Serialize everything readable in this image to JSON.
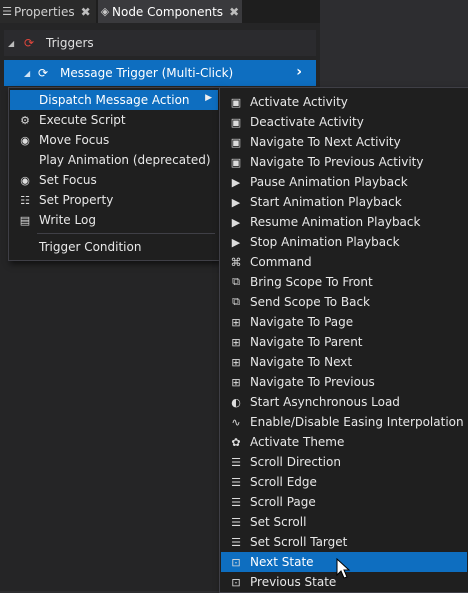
{
  "tabs": [
    {
      "label": "Properties",
      "icon": "list-icon",
      "close": "✖"
    },
    {
      "label": "Node Components",
      "icon": "node-components-icon",
      "close": "✖"
    }
  ],
  "tree": {
    "triggers_label": "Triggers",
    "message_trigger_label": "Message Trigger (Multi-Click)"
  },
  "menu_main": {
    "items": [
      {
        "label": "Dispatch Message Action",
        "icon": "",
        "submenu": true,
        "highlight": true
      },
      {
        "label": "Execute Script",
        "icon": "script-icon"
      },
      {
        "label": "Move Focus",
        "icon": "focus-icon"
      },
      {
        "label": "Play Animation (deprecated)",
        "icon": ""
      },
      {
        "label": "Set Focus",
        "icon": "focus-icon"
      },
      {
        "label": "Set Property",
        "icon": "property-icon"
      },
      {
        "label": "Write Log",
        "icon": "log-icon"
      }
    ],
    "trigger_condition": "Trigger Condition"
  },
  "menu_sub": {
    "items": [
      {
        "label": "Activate Activity",
        "icon": "activity-icon"
      },
      {
        "label": "Deactivate Activity",
        "icon": "activity-icon"
      },
      {
        "label": "Navigate To Next Activity",
        "icon": "activity-icon"
      },
      {
        "label": "Navigate To Previous Activity",
        "icon": "activity-icon"
      },
      {
        "label": "Pause Animation Playback",
        "icon": "animation-icon"
      },
      {
        "label": "Start Animation Playback",
        "icon": "animation-icon"
      },
      {
        "label": "Resume Animation Playback",
        "icon": "animation-icon"
      },
      {
        "label": "Stop Animation Playback",
        "icon": "animation-icon"
      },
      {
        "label": "Command",
        "icon": "command-icon"
      },
      {
        "label": "Bring Scope To Front",
        "icon": "scope-icon"
      },
      {
        "label": "Send Scope To Back",
        "icon": "scope-icon"
      },
      {
        "label": "Navigate To Page",
        "icon": "navigation-icon"
      },
      {
        "label": "Navigate To Parent",
        "icon": "navigation-icon"
      },
      {
        "label": "Navigate To Next",
        "icon": "navigation-icon"
      },
      {
        "label": "Navigate To Previous",
        "icon": "navigation-icon"
      },
      {
        "label": "Start Asynchronous Load",
        "icon": "load-icon"
      },
      {
        "label": "Enable/Disable Easing Interpolation",
        "icon": "easing-icon"
      },
      {
        "label": "Activate Theme",
        "icon": "theme-icon"
      },
      {
        "label": "Scroll Direction",
        "icon": "scroll-icon"
      },
      {
        "label": "Scroll Edge",
        "icon": "scroll-icon"
      },
      {
        "label": "Scroll Page",
        "icon": "scroll-icon"
      },
      {
        "label": "Set Scroll",
        "icon": "scroll-icon"
      },
      {
        "label": "Set Scroll Target",
        "icon": "scroll-icon"
      },
      {
        "label": "Next State",
        "icon": "state-icon",
        "highlight": true
      },
      {
        "label": "Previous State",
        "icon": "state-icon"
      }
    ]
  },
  "colors": {
    "highlight": "#0e6ec0",
    "menu_bg": "#1f1f1f",
    "trigger_icon": "#e0463c"
  }
}
